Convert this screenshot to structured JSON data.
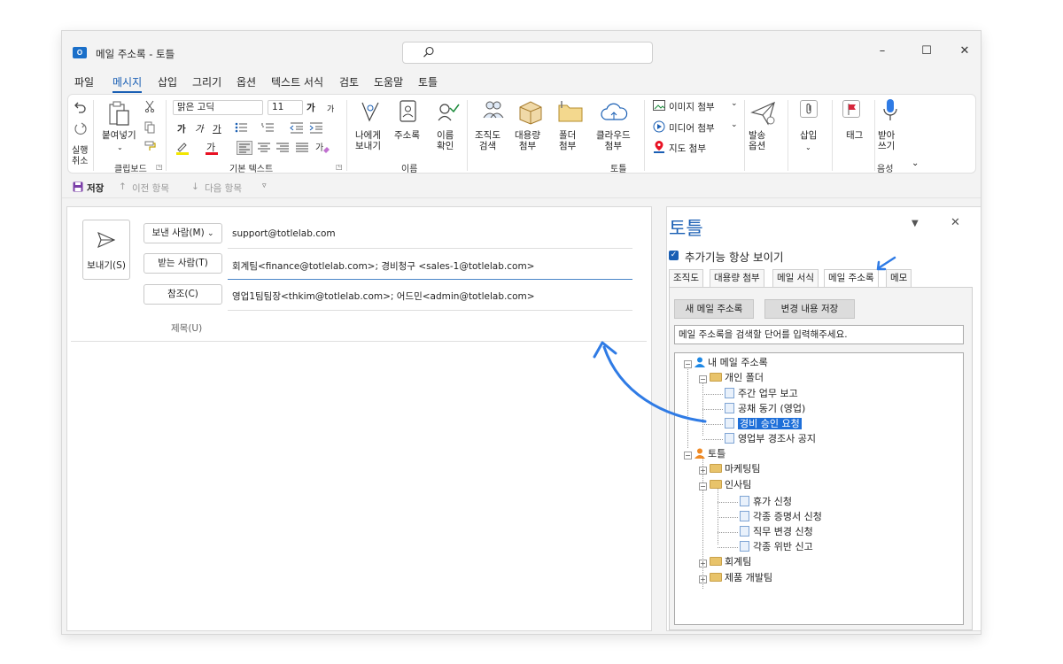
{
  "window": {
    "title": "메일 주소록 - 토틀",
    "app_icon_letter": "O"
  },
  "window_controls": {
    "minimize": "–",
    "maximize": "☐",
    "close": "✕"
  },
  "menu": [
    "파일",
    "메시지",
    "삽입",
    "그리기",
    "옵션",
    "텍스트 서식",
    "검토",
    "도움말",
    "토틀"
  ],
  "menu_active": "메시지",
  "ribbon": {
    "undo_group": "실행\n취소",
    "clipboard": {
      "paste": "붙여넣기",
      "group": "클립보드"
    },
    "font": {
      "name": "맑은 고딕",
      "size": "11",
      "grow": "가",
      "shrink": "가",
      "bold": "가",
      "italic": "가",
      "underline": "가",
      "group": "기본 텍스트"
    },
    "names": {
      "to_me": "나에게\n보내기",
      "address_book": "주소록",
      "check_names": "이름\n확인",
      "group": "이름"
    },
    "totle": {
      "org": "조직도\n검색",
      "large": "대용량\n첨부",
      "folder": "폴더\n첨부",
      "cloud": "클라우드\n첨부",
      "group": "토틀"
    },
    "attach": {
      "image": "이미지 첨부",
      "media": "미디어 첨부",
      "map": "지도 첨부"
    },
    "send_options": "발송\n옵션",
    "insert": "삽입",
    "tag": "태그",
    "dictate": "받아\n쓰기",
    "voice_group": "음성"
  },
  "qat": {
    "save": "저장",
    "prev": "이전 항목",
    "next": "다음 항목"
  },
  "compose": {
    "send_label": "보내기(S)",
    "from_button": "보낸 사람(M)",
    "from_value": "support@totlelab.com",
    "to_button": "받는 사람(T)",
    "to_value": "회계팀<finance@totlelab.com>; 경비청구 <sales-1@totlelab.com>",
    "cc_button": "참조(C)",
    "cc_value": "영업1팀팀장<thkim@totlelab.com>; 어드민<admin@totlelab.com>",
    "subject_label": "제목(U)"
  },
  "pane": {
    "title": "토틀",
    "always_show": "추가기능 항상 보이기",
    "tabs": [
      "조직도",
      "대용량 첨부",
      "메일 서식",
      "메일 주소록",
      "메모"
    ],
    "active_tab": "메일 주소록",
    "new_button": "새 메일 주소록",
    "save_button": "변경 내용 저장",
    "search_placeholder": "메일 주소록을 검색할 단어를 입력해주세요.",
    "tree": {
      "my_book": "내 메일 주소록",
      "personal_folder": "개인 폴더",
      "personal_items": [
        "주간 업무 보고",
        "공채 동기 (영업)",
        "경비 승인 요청",
        "영업부 경조사 공지"
      ],
      "selected": "경비 승인 요청",
      "totle": "토틀",
      "marketing": "마케팅팀",
      "hr": "인사팀",
      "hr_items": [
        "휴가 신청",
        "각종 증명서 신청",
        "직무 변경 신청",
        "각종 위반 신고"
      ],
      "accounting": "회계팀",
      "product": "제품 개발팀"
    }
  },
  "colors": {
    "accent": "#1a5fb4",
    "selection": "#1e6fd9",
    "annotation_arrow": "#2f7be5"
  }
}
